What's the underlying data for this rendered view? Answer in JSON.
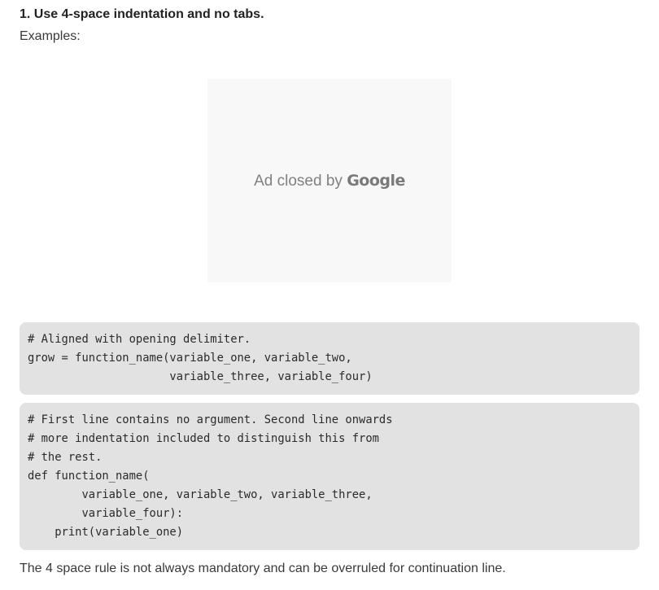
{
  "section": {
    "heading": "1. Use 4-space indentation and no tabs.",
    "subheading": "Examples:"
  },
  "ad": {
    "prefix": "Ad closed by ",
    "brand": "Google"
  },
  "code_blocks": [
    {
      "lines": [
        "# Aligned with opening delimiter.",
        "grow = function_name(variable_one, variable_two,",
        "                     variable_three, variable_four)"
      ]
    },
    {
      "lines": [
        "# First line contains no argument. Second line onwards",
        "# more indentation included to distinguish this from",
        "# the rest.",
        "def function_name(",
        "        variable_one, variable_two, variable_three,",
        "        variable_four):",
        "    print(variable_one)"
      ]
    }
  ],
  "footer": {
    "text": "The 4 space rule is not always mandatory and can be overruled for continuation line."
  }
}
